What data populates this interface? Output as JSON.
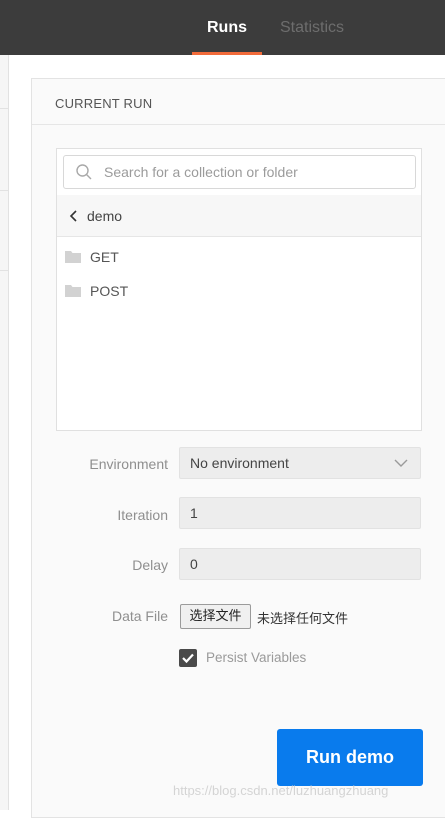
{
  "tabs": {
    "runs_label": "Runs",
    "statistics_label": "Statistics"
  },
  "panel": {
    "title": "CURRENT RUN"
  },
  "collection": {
    "search_placeholder": "Search for a collection or folder",
    "breadcrumb_label": "demo",
    "folders": [
      {
        "label": "GET"
      },
      {
        "label": "POST"
      }
    ]
  },
  "form": {
    "environment_label": "Environment",
    "environment_value": "No environment",
    "iteration_label": "Iteration",
    "iteration_value": "1",
    "delay_label": "Delay",
    "delay_value": "0",
    "datafile_label": "Data File",
    "file_button_label": "选择文件",
    "file_status": "未选择任何文件",
    "persist_label": "Persist Variables",
    "persist_checked": true
  },
  "run_button_label": "Run demo",
  "watermark": "https://blog.csdn.net/luzhuangzhuang",
  "colors": {
    "accent_tab": "#f26b3a",
    "run_button": "#097bed",
    "topbar": "#3c3c3c"
  }
}
